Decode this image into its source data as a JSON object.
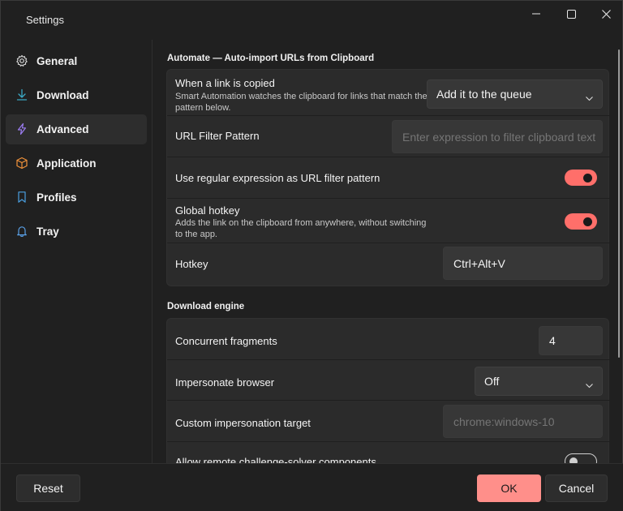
{
  "window": {
    "title": "Settings",
    "controls": {
      "minimize": "minimize-icon",
      "maximize": "maximize-icon",
      "close": "close-icon"
    }
  },
  "sidebar": {
    "items": [
      {
        "label": "General",
        "icon": "gear-icon"
      },
      {
        "label": "Download",
        "icon": "download-icon"
      },
      {
        "label": "Advanced",
        "icon": "lightning-icon",
        "active": true
      },
      {
        "label": "Application",
        "icon": "box-icon"
      },
      {
        "label": "Profiles",
        "icon": "bookmark-icon"
      },
      {
        "label": "Tray",
        "icon": "bell-icon"
      }
    ]
  },
  "automate": {
    "title": "Automate  —  Auto-import URLs from Clipboard",
    "when_copied": {
      "label": "When a link is copied",
      "description": "Smart Automation watches the clipboard for links that match the pattern below.",
      "value": "Add it to the queue"
    },
    "url_filter": {
      "label": "URL Filter Pattern",
      "placeholder": "Enter expression to filter clipboard text"
    },
    "use_regex": {
      "label": "Use regular expression as URL filter pattern",
      "on": true
    },
    "global_hotkey": {
      "label": "Global hotkey",
      "description": "Adds the link on the clipboard from anywhere, without switching to the app.",
      "on": true
    },
    "hotkey": {
      "label": "Hotkey",
      "value": "Ctrl+Alt+V"
    }
  },
  "engine": {
    "title": "Download engine",
    "concurrent": {
      "label": "Concurrent fragments",
      "value": "4"
    },
    "impersonate": {
      "label": "Impersonate browser",
      "value": "Off"
    },
    "custom_target": {
      "label": "Custom impersonation target",
      "placeholder": "chrome:windows-10"
    },
    "remote_challenge": {
      "label": "Allow remote challenge-solver components",
      "on": false
    }
  },
  "footer": {
    "reset": "Reset",
    "ok": "OK",
    "cancel": "Cancel"
  },
  "colors": {
    "accent": "#ff6f6a",
    "ok_button": "#ff8f8a",
    "background": "#202020",
    "card": "#2b2b2b"
  }
}
